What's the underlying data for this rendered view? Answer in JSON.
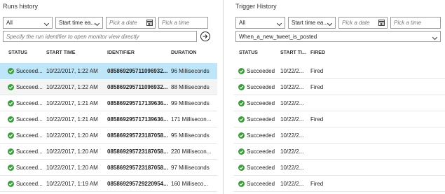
{
  "runs": {
    "title": "Runs history",
    "filter_status": "All",
    "filter_sort": "Start time ea...",
    "date_placeholder": "Pick a date",
    "time_placeholder": "Pick a time",
    "identifier_placeholder": "Specify the run identifier to open monitor view directly",
    "columns": {
      "status": "STATUS",
      "start_time": "START TIME",
      "identifier": "IDENTIFIER",
      "duration": "DURATION"
    },
    "rows": [
      {
        "status": "Succeed...",
        "start_time": "10/22/2017, 1:22 AM",
        "identifier": "085869295711096932...",
        "duration": "96 Milliseconds"
      },
      {
        "status": "Succeed...",
        "start_time": "10/22/2017, 1:22 AM",
        "identifier": "085869295711096932...",
        "duration": "88 Milliseconds"
      },
      {
        "status": "Succeed...",
        "start_time": "10/22/2017, 1:21 AM",
        "identifier": "085869295717139636...",
        "duration": "99 Milliseconds"
      },
      {
        "status": "Succeed...",
        "start_time": "10/22/2017, 1:21 AM",
        "identifier": "085869295717139636...",
        "duration": "171 Millisecon..."
      },
      {
        "status": "Succeed...",
        "start_time": "10/22/2017, 1:20 AM",
        "identifier": "085869295723187058...",
        "duration": "95 Milliseconds"
      },
      {
        "status": "Succeed...",
        "start_time": "10/22/2017, 1:20 AM",
        "identifier": "085869295723187058...",
        "duration": "220 Millisecon..."
      },
      {
        "status": "Succeed...",
        "start_time": "10/22/2017, 1:20 AM",
        "identifier": "085869295723187058...",
        "duration": "97 Milliseconds"
      },
      {
        "status": "Succeed...",
        "start_time": "10/22/2017, 1:19 AM",
        "identifier": "085869295729220954...",
        "duration": "160 Milliseco..."
      }
    ]
  },
  "trigger": {
    "title": "Trigger History",
    "filter_status": "All",
    "filter_sort": "Start time ea...",
    "date_placeholder": "Pick a date",
    "time_placeholder": "Pick a time",
    "trigger_name": "When_a_new_tweet_is_posted",
    "columns": {
      "status": "STATUS",
      "start_time": "START TI...",
      "fired": "FIRED"
    },
    "rows": [
      {
        "status": "Succeeded",
        "start_time": "10/22/2...",
        "fired": "Fired"
      },
      {
        "status": "Succeeded",
        "start_time": "10/22/2...",
        "fired": "Fired"
      },
      {
        "status": "Succeeded",
        "start_time": "10/22/2...",
        "fired": ""
      },
      {
        "status": "Succeeded",
        "start_time": "10/22/2...",
        "fired": "Fired"
      },
      {
        "status": "Succeeded",
        "start_time": "10/22/2...",
        "fired": ""
      },
      {
        "status": "Succeeded",
        "start_time": "10/22/2...",
        "fired": ""
      },
      {
        "status": "Succeeded",
        "start_time": "10/22/2...",
        "fired": ""
      },
      {
        "status": "Succeeded",
        "start_time": "10/22/2...",
        "fired": "Fired"
      }
    ]
  },
  "colors": {
    "success": "#3a9e3a",
    "selected_row": "#bfe6f8"
  },
  "icons": {
    "status": "checkmark-circle-icon",
    "go": "arrow-right-circle-icon",
    "calendar": "calendar-icon",
    "dropdown": "chevron-down-icon"
  }
}
